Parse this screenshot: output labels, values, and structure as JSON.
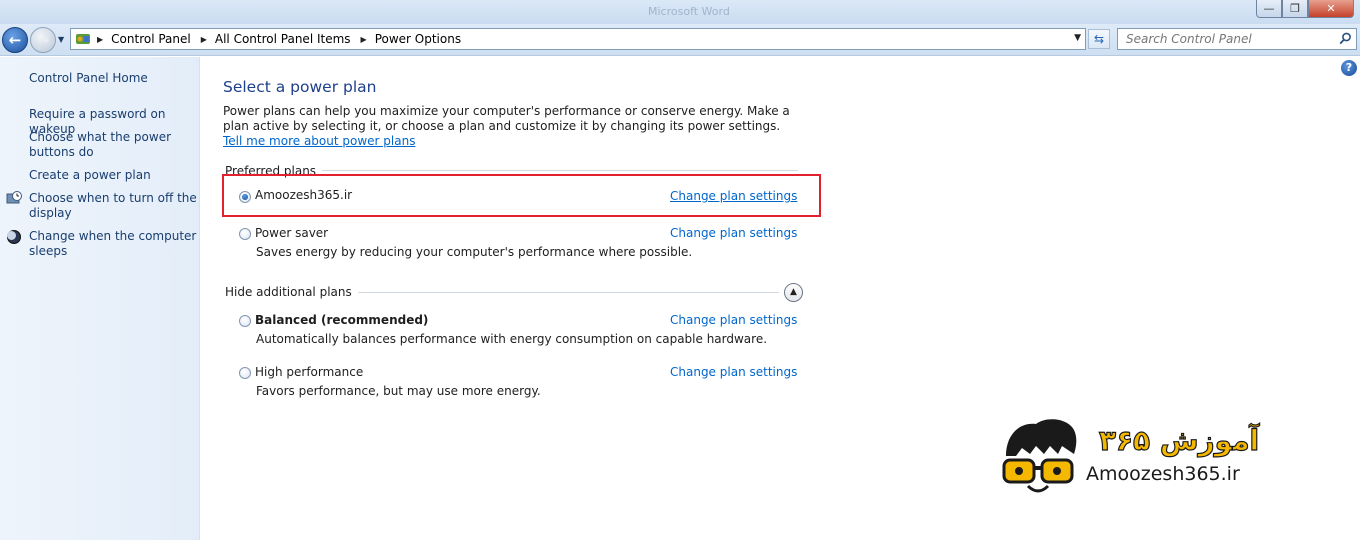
{
  "window": {
    "title_ghost": "Microsoft Word"
  },
  "address_bar": {
    "breadcrumbs": [
      "Control Panel",
      "All Control Panel Items",
      "Power Options"
    ],
    "search_placeholder": "Search Control Panel"
  },
  "sidebar": {
    "items": [
      {
        "label": "Control Panel Home",
        "icon": null
      },
      {
        "label": "Require a password on wakeup",
        "icon": null
      },
      {
        "label": "Choose what the power buttons do",
        "icon": null
      },
      {
        "label": "Create a power plan",
        "icon": null
      },
      {
        "label": "Choose when to turn off the display",
        "icon": "display-clock-icon"
      },
      {
        "label": "Change when the computer sleeps",
        "icon": "moon-icon"
      }
    ]
  },
  "main": {
    "title": "Select a power plan",
    "intro_text": "Power plans can help you maximize your computer's performance or conserve energy. Make a plan active by selecting it, or choose a plan and customize it by changing its power settings.",
    "intro_link": "Tell me more about power plans",
    "preferred_label": "Preferred plans",
    "hidden_label": "Hide additional plans",
    "change_link_label": "Change plan settings",
    "plans": [
      {
        "name": "Amoozesh365.ir",
        "description": "",
        "selected": true,
        "bold": false
      },
      {
        "name": "Power saver",
        "description": "Saves energy by reducing your computer's performance where possible.",
        "selected": false,
        "bold": false
      },
      {
        "name": "Balanced (recommended)",
        "description": "Automatically balances performance with energy consumption on capable hardware.",
        "selected": false,
        "bold": true
      },
      {
        "name": "High performance",
        "description": "Favors performance, but may use more energy.",
        "selected": false,
        "bold": false
      }
    ]
  },
  "watermark": {
    "site": "Amoozesh365.ir",
    "persian_text": "آموزش ۳۶۵"
  },
  "colors": {
    "link": "#0066cc",
    "title": "#1e3f8c",
    "highlight_border": "#e3202e",
    "logo_yellow": "#f5b800"
  }
}
